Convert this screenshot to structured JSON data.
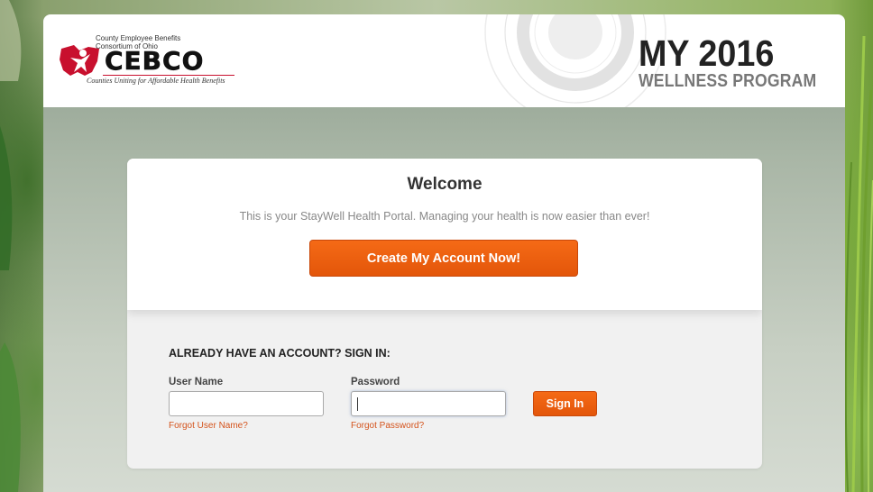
{
  "header": {
    "logo": {
      "tagline_line1": "County Employee Benefits",
      "tagline_line2": "Consortium of Ohio",
      "wordmark": "CEBCO",
      "slogan": "Counties Uniting for Affordable Health Benefits"
    },
    "program_title": "MY 2016",
    "program_subtitle": "WELLNESS PROGRAM"
  },
  "welcome": {
    "heading": "Welcome",
    "message": "This is your StayWell Health Portal. Managing your health is now easier than ever!",
    "create_account_label": "Create My Account Now!"
  },
  "signin": {
    "heading": "ALREADY HAVE AN ACCOUNT? SIGN IN:",
    "username_label": "User Name",
    "username_value": "",
    "password_label": "Password",
    "password_value": "",
    "forgot_username_label": "Forgot User Name?",
    "forgot_password_label": "Forgot Password?",
    "signin_label": "Sign In"
  },
  "colors": {
    "accent_orange": "#e95d0f",
    "link_orange": "#d4531c",
    "logo_red": "#c8102e"
  },
  "icons": {
    "logo_mark": "ohio-state-figure-icon"
  }
}
